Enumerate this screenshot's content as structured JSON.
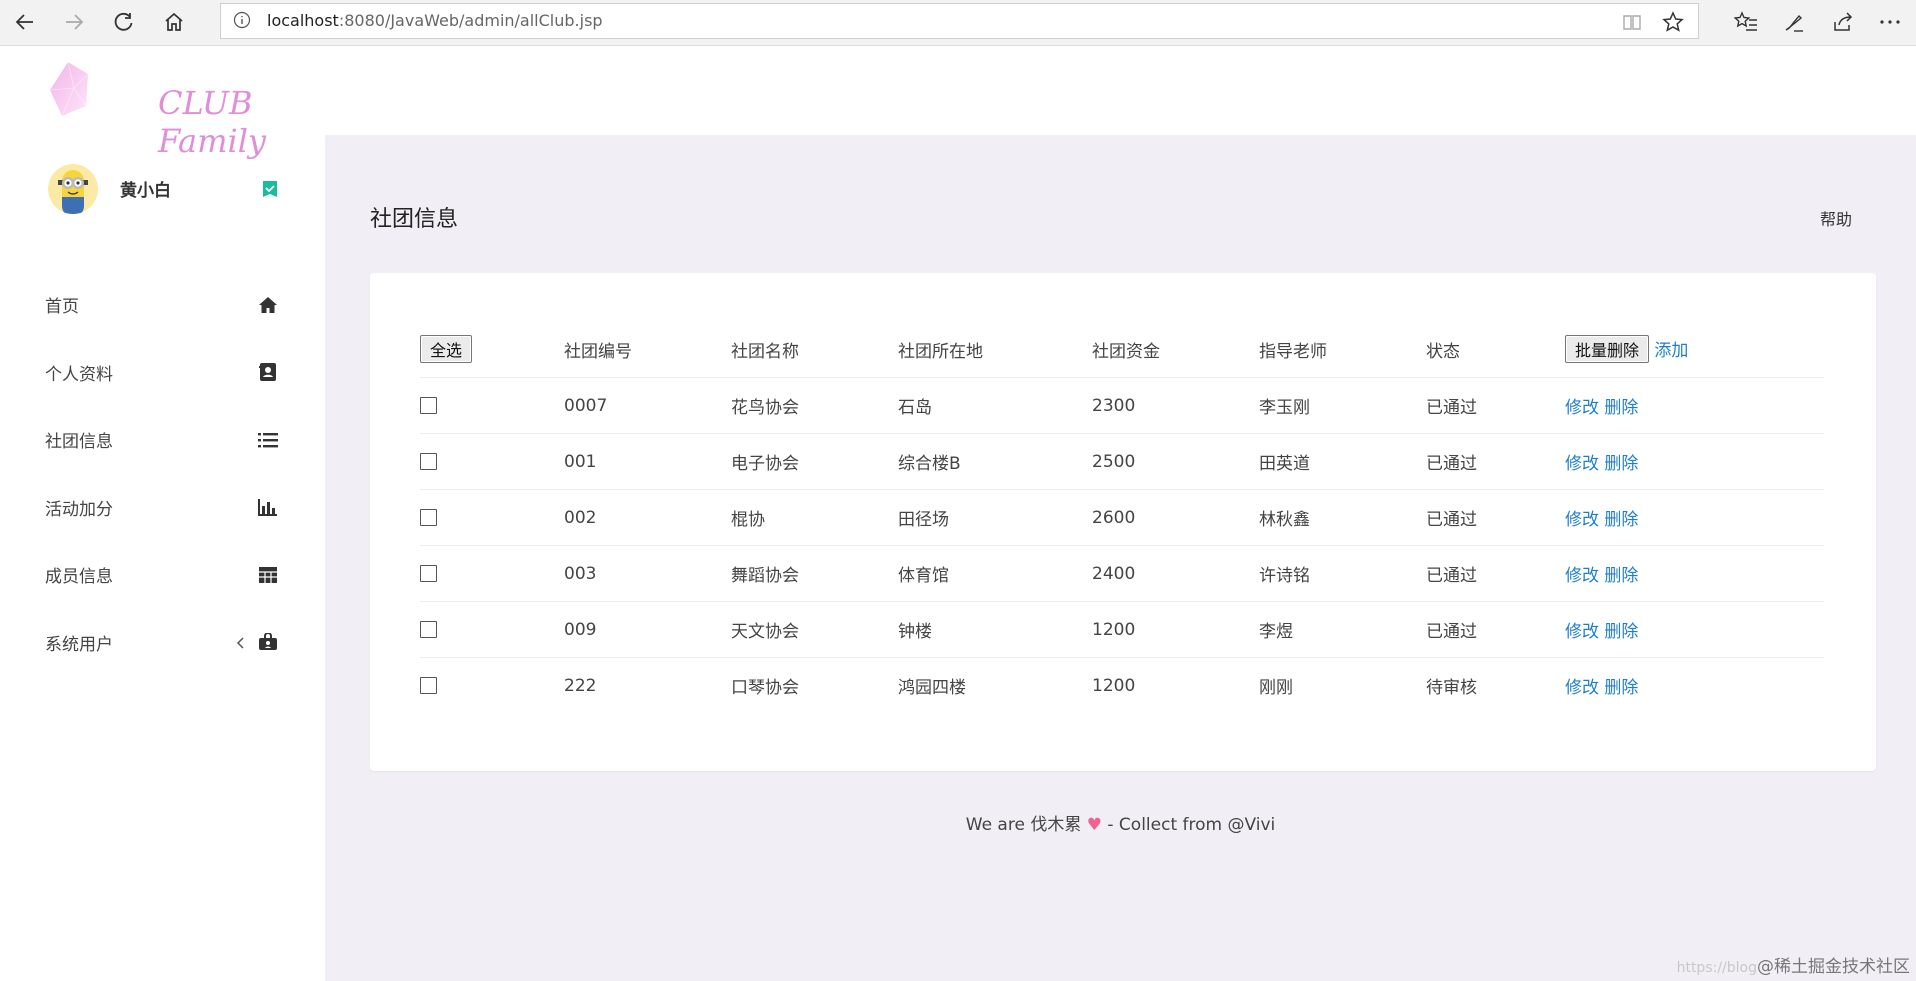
{
  "browser": {
    "url_host": "localhost",
    "url_rest": ":8080/JavaWeb/admin/allClub.jsp"
  },
  "sidebar": {
    "logo_text": "CLUB Family",
    "username": "黄小白",
    "items": [
      {
        "label": "首页",
        "icon": "home-icon"
      },
      {
        "label": "个人资料",
        "icon": "contact-card-icon"
      },
      {
        "label": "社团信息",
        "icon": "list-icon"
      },
      {
        "label": "活动加分",
        "icon": "bar-chart-icon"
      },
      {
        "label": "成员信息",
        "icon": "table-icon"
      },
      {
        "label": "系统用户",
        "icon": "user-lock-icon"
      }
    ]
  },
  "main": {
    "title": "社团信息",
    "help": "帮助"
  },
  "table": {
    "select_all": "全选",
    "batch_delete": "批量删除",
    "add": "添加",
    "headers": [
      "社团编号",
      "社团名称",
      "社团所在地",
      "社团资金",
      "指导老师",
      "状态"
    ],
    "edit_label": "修改",
    "delete_label": "删除",
    "rows": [
      {
        "id": "0007",
        "name": "花鸟协会",
        "location": "石岛",
        "funds": "2300",
        "teacher": "李玉刚",
        "status": "已通过"
      },
      {
        "id": "001",
        "name": "电子协会",
        "location": "综合楼B",
        "funds": "2500",
        "teacher": "田英道",
        "status": "已通过"
      },
      {
        "id": "002",
        "name": "棍协",
        "location": "田径场",
        "funds": "2600",
        "teacher": "林秋鑫",
        "status": "已通过"
      },
      {
        "id": "003",
        "name": "舞蹈协会",
        "location": "体育馆",
        "funds": "2400",
        "teacher": "许诗铭",
        "status": "已通过"
      },
      {
        "id": "009",
        "name": "天文协会",
        "location": "钟楼",
        "funds": "1200",
        "teacher": "李煜",
        "status": "已通过"
      },
      {
        "id": "222",
        "name": "口琴协会",
        "location": "鸿园四楼",
        "funds": "1200",
        "teacher": "刚刚",
        "status": "待审核"
      }
    ]
  },
  "footer": {
    "prefix": "We are 伐木累",
    "heart": "♥",
    "suffix": "- Collect from @Vivi"
  },
  "watermark": {
    "faint": "https://blog",
    "text": "@稀土掘金技术社区"
  },
  "colors": {
    "main_bg": "#f2eef5",
    "link": "#1f7ed0",
    "logo": "#e08ed8",
    "verified": "#1abc9c"
  }
}
